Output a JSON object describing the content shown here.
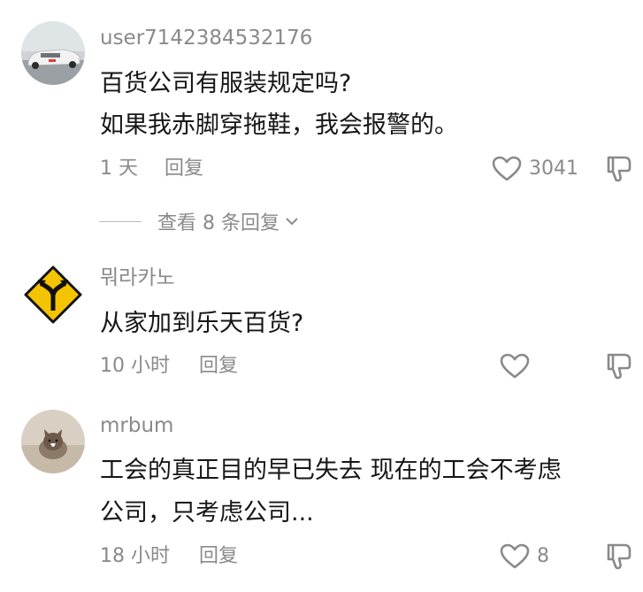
{
  "comments": [
    {
      "username": "user7142384532176",
      "lines": [
        "百货公司有服装规定吗?",
        "如果我赤脚穿拖鞋，我会报警的。"
      ],
      "time": "1 天",
      "reply_label": "回复",
      "likes": "3041",
      "view_replies": "查看 8 条回复"
    },
    {
      "username": "뭐라카노",
      "lines": [
        "从家加到乐天百货?"
      ],
      "time": "10 小时",
      "reply_label": "回复",
      "likes": ""
    },
    {
      "username": "mrbum",
      "lines": [
        "工会的真正目的早已失去  现在的工会不考虑",
        "公司，只考虑公司..."
      ],
      "time": "18 小时",
      "reply_label": "回复",
      "likes": "8"
    }
  ],
  "icons": {
    "like": "heart-outline-icon",
    "dislike": "thumbs-down-outline-icon",
    "expand": "chevron-down-icon"
  },
  "colors": {
    "text": "#161616",
    "secondary": "#8a8a8a",
    "sign_yellow": "#f5c400"
  }
}
